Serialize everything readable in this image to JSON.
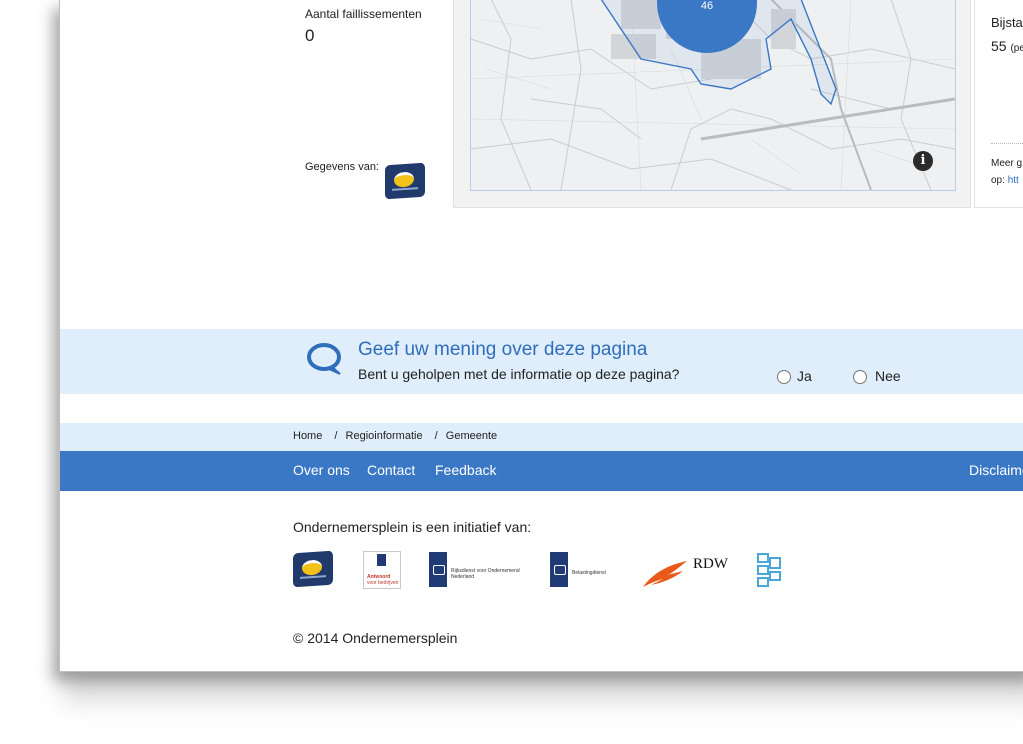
{
  "stats": {
    "faillissementen_label": "Aantal faillissementen",
    "faillissementen_value": "0",
    "source_label": "Gegevens van:",
    "source_logo_name": "kvk-logo"
  },
  "map": {
    "cluster_value": "46",
    "info_icon": "i"
  },
  "right_panel": {
    "label": "Bijsta",
    "value": "55",
    "value_suffix": "(pe",
    "meer_text": "Meer g",
    "link_prefix": "op:",
    "link_text": "htt"
  },
  "feedback": {
    "title": "Geef uw mening over deze pagina",
    "question": "Bent u geholpen met de informatie op deze pagina?",
    "option_yes": "Ja",
    "option_no": "Nee"
  },
  "breadcrumb": {
    "home": "Home",
    "sep": "/",
    "regio": "Regioinformatie",
    "gemeente": "Gemeente"
  },
  "nav": {
    "over_ons": "Over ons",
    "contact": "Contact",
    "feedback": "Feedback",
    "disclaimer": "Disclaime"
  },
  "footer": {
    "intro": "Ondernemersplein is een initiatief van:",
    "logos": {
      "antwoord_line1": "Antwoord",
      "antwoord_line2": "voor bedrijven",
      "rvo_line1": "Rijksdienst voor Ondernemend",
      "rvo_line2": "Nederland",
      "belasting": "Belastingdienst",
      "rdw": "RDW"
    },
    "copyright": "© 2014 Ondernemersplein"
  },
  "colors": {
    "brand_blue": "#3a78c5",
    "light_blue": "#dfeefa",
    "map_cluster": "#3a78c5"
  }
}
